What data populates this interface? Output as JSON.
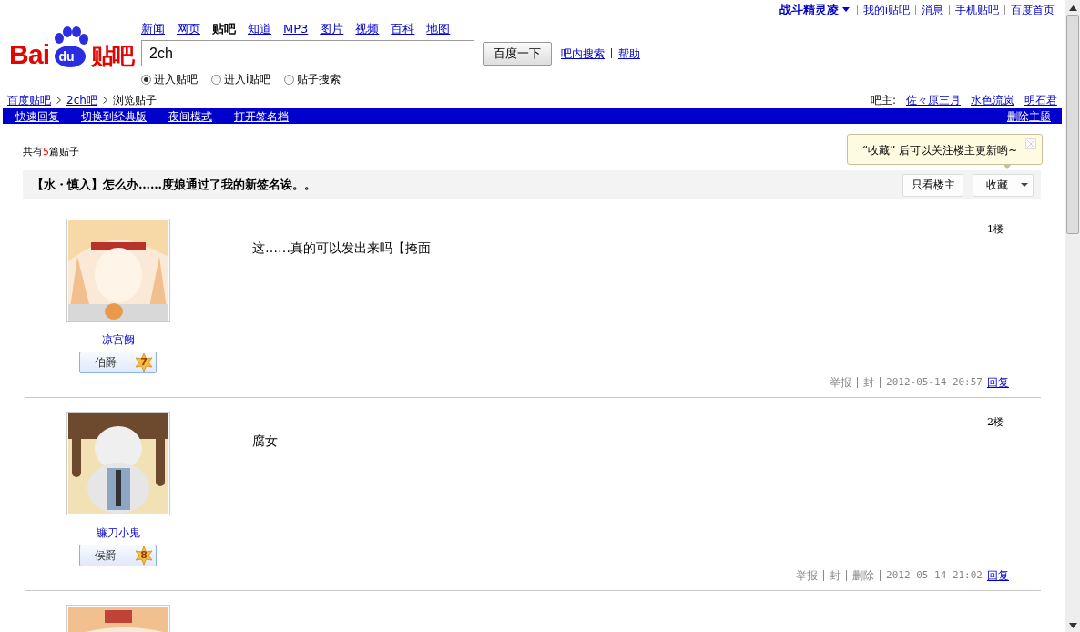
{
  "user_bar": {
    "username": "战斗精灵凌",
    "links": [
      "我的i贴吧",
      "消息",
      "手机贴吧",
      "百度首页"
    ]
  },
  "logo": {
    "brand": "Bai",
    "paw": "du",
    "product": "贴吧"
  },
  "nav": [
    {
      "label": "新闻",
      "selected": false
    },
    {
      "label": "网页",
      "selected": false
    },
    {
      "label": "贴吧",
      "selected": true
    },
    {
      "label": "知道",
      "selected": false
    },
    {
      "label": "MP3",
      "selected": false
    },
    {
      "label": "图片",
      "selected": false
    },
    {
      "label": "视频",
      "selected": false
    },
    {
      "label": "百科",
      "selected": false
    },
    {
      "label": "地图",
      "selected": false
    }
  ],
  "search": {
    "value": "2ch",
    "button": "百度一下",
    "links": [
      "吧内搜索",
      "帮助"
    ],
    "options": [
      {
        "label": "进入贴吧",
        "selected": true
      },
      {
        "label": "进入i贴吧",
        "selected": false
      },
      {
        "label": "贴子搜索",
        "selected": false
      }
    ]
  },
  "breadcrumb": [
    {
      "label": "百度贴吧",
      "link": true
    },
    {
      "label": "2ch吧",
      "link": true
    },
    {
      "label": "浏览贴子",
      "link": false
    }
  ],
  "managers": {
    "label": "吧主:",
    "names": [
      "佐々原三月",
      "水色流岚",
      "明石君"
    ]
  },
  "toolbar": {
    "left": [
      "快速回复",
      "切换到经典版",
      "夜间模式",
      "打开签名档"
    ],
    "right": "删除主题"
  },
  "post_count": {
    "before": "共有",
    "count": "5",
    "after": "篇贴子"
  },
  "tooltip": {
    "text": "“收藏” 后可以关注楼主更新哟~"
  },
  "thread": {
    "title": "【水・慎入】怎么办……度娘通过了我的新签名诶。。",
    "buttons": [
      "只看楼主",
      "收藏"
    ]
  },
  "posts": [
    {
      "author": "凉宫阙",
      "rank": "伯爵",
      "level": "7",
      "content": "这……真的可以发出来吗【掩面",
      "floor": "1楼",
      "actions": [
        "举报",
        "封"
      ],
      "time": "2012-05-14 20:57",
      "reply": "回复"
    },
    {
      "author": "镰刀小鬼",
      "rank": "侯爵",
      "level": "8",
      "content": "腐女",
      "floor": "2楼",
      "actions": [
        "举报",
        "封",
        "删除"
      ],
      "time": "2012-05-14 21:02",
      "reply": "回复"
    },
    {
      "avatar": {
        "kind": "picture"
      }
    }
  ]
}
